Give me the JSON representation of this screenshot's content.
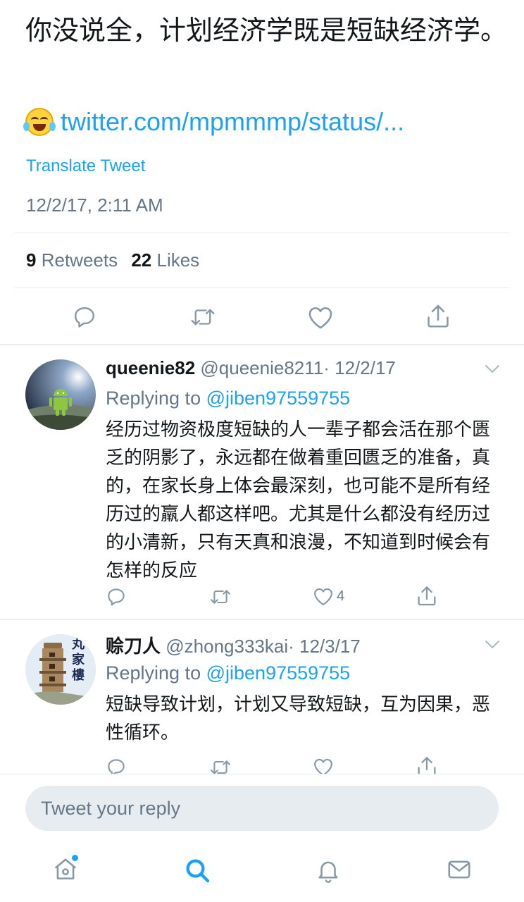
{
  "tweet": {
    "text": "你没说全，计划经济学既是短缺经济学。",
    "emoji": "joy-emoji",
    "link": "twitter.com/mpmmmp/status/...",
    "translate_label": "Translate Tweet",
    "timestamp": "12/2/17, 2:11 AM",
    "retweets_count": "9",
    "retweets_label": "Retweets",
    "likes_count": "22",
    "likes_label": "Likes"
  },
  "replies": [
    {
      "name": "queenie82",
      "handle": "@queenie8211",
      "date": "· 12/2/17",
      "replying_prefix": "Replying to",
      "replying_to": "@jiben97559755",
      "text": "经历过物资极度短缺的人一辈子都会活在那个匮乏的阴影了，永远都在做着重回匮乏的准备，真的，在家长身上体会最深刻，也可能不是所有经历过的羸人都这样吧。尤其是什么都没有经历过的小清新，只有天真和浪漫，不知道到时候会有怎样的反应",
      "likes": "4"
    },
    {
      "name": "赊刀人",
      "handle": "@zhong333kai",
      "date": "· 12/3/17",
      "replying_prefix": "Replying to",
      "replying_to": "@jiben97559755",
      "text": "短缺导致计划，计划又导致短缺，互为因果，恶性循环。",
      "avatar_text": "丸家樓"
    }
  ],
  "compose": {
    "placeholder": "Tweet your reply"
  },
  "tabs": [
    "home-icon",
    "search-icon",
    "notifications-icon",
    "messages-icon"
  ],
  "colors": {
    "accent": "#1da1f2",
    "secondary_text": "#657786",
    "icon_gray": "#8899a6",
    "divider": "#e6ecf0"
  }
}
